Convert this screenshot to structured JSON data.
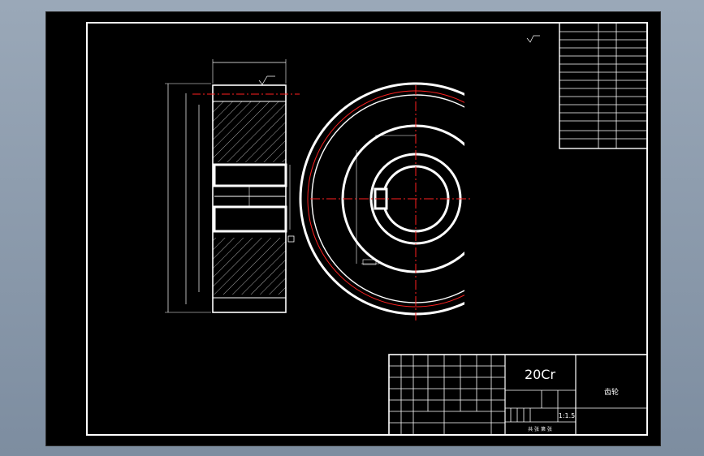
{
  "drawing": {
    "material": "20Cr",
    "part_name": "齿轮",
    "scale": "1:1.5",
    "sheet_label": "共 张 第 张"
  },
  "colors": {
    "background": "#000000",
    "line": "#ffffff",
    "center_line": "#ff2020",
    "chrome": "#8d9cb0"
  },
  "icons": [
    "hatch-pattern",
    "roughness-symbol"
  ]
}
